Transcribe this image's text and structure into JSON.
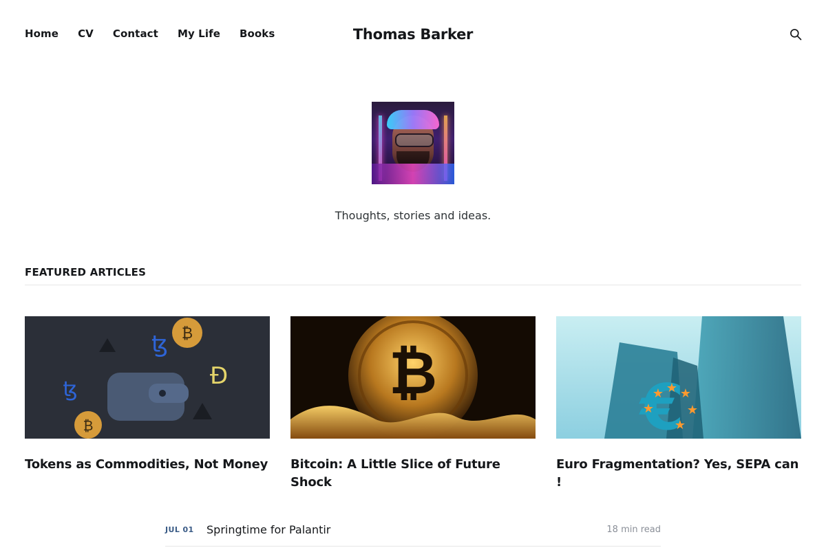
{
  "header": {
    "nav": [
      {
        "label": "Home"
      },
      {
        "label": "CV"
      },
      {
        "label": "Contact"
      },
      {
        "label": "My Life"
      },
      {
        "label": "Books"
      }
    ],
    "site_title": "Thomas Barker",
    "search_icon": "search-icon"
  },
  "hero": {
    "avatar_alt": "Neon cyberpunk portrait avatar",
    "tagline": "Thoughts, stories and ideas."
  },
  "featured": {
    "section_title": "FEATURED ARTICLES",
    "articles": [
      {
        "title": "Tokens as Commodities, Not Money"
      },
      {
        "title": "Bitcoin: A Little Slice of Future Shock"
      },
      {
        "title": "Euro Fragmentation? Yes, SEPA can !"
      }
    ]
  },
  "latest": {
    "items": [
      {
        "date": "JUL 01",
        "title": "Springtime for Palantir",
        "read_time": "18 min read"
      }
    ]
  },
  "colors": {
    "text": "#15171a",
    "date_accent": "#3a5b86",
    "muted": "#8a8f98",
    "rule": "#e6e6e6"
  }
}
